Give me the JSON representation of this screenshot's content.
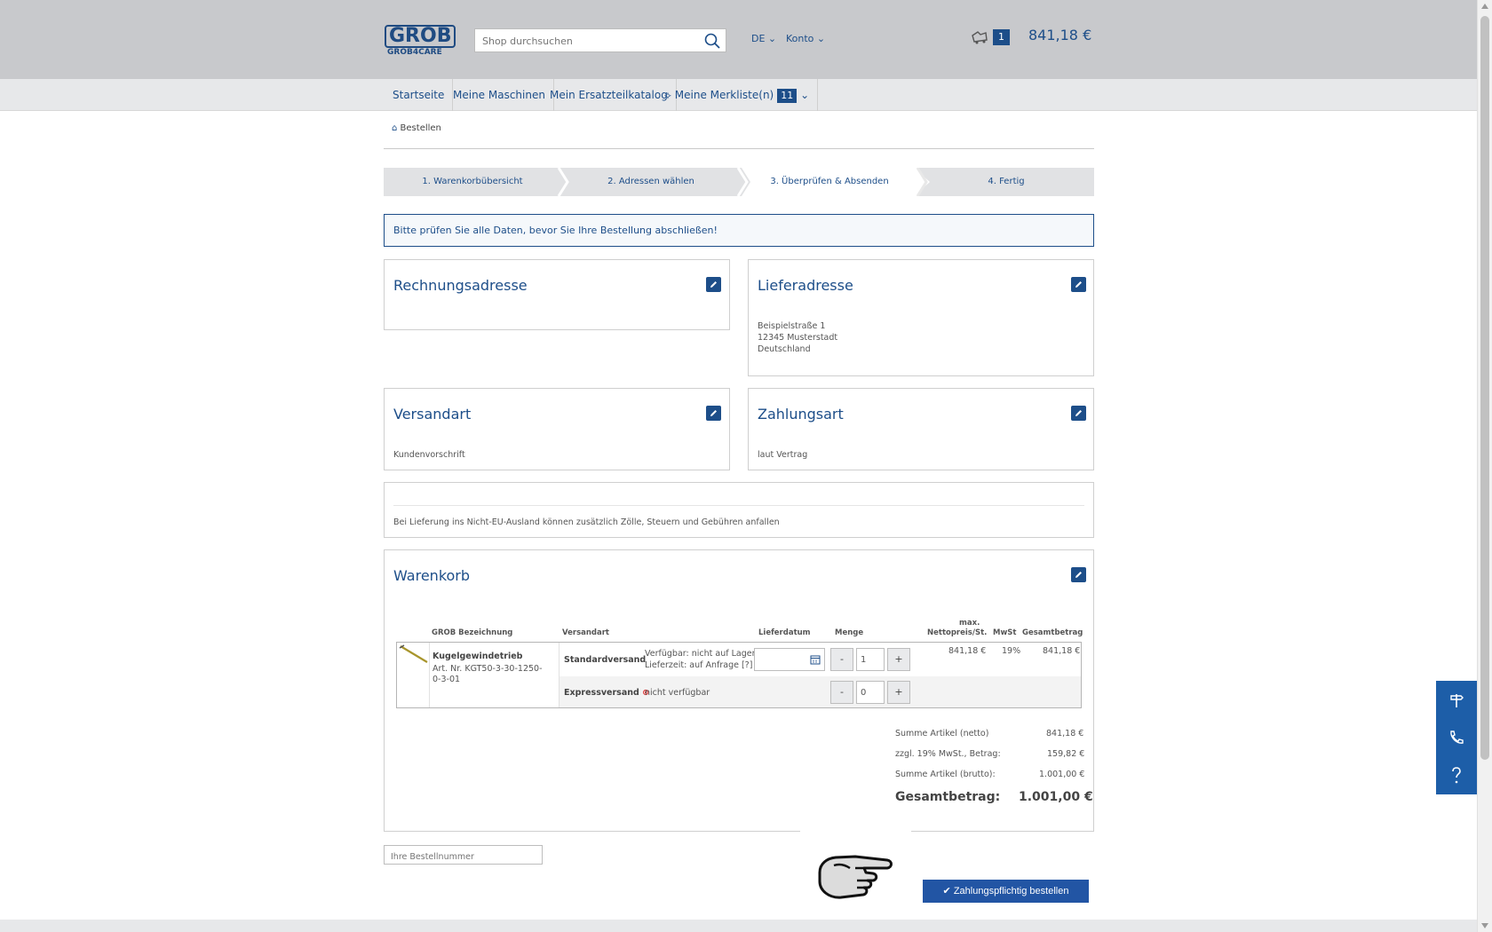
{
  "header": {
    "logo_top": "GROB",
    "logo_bottom": "GROB4CARE",
    "search_placeholder": "Shop durchsuchen",
    "language": "DE",
    "account": "Konto",
    "cart_count": "1",
    "cart_total": "841,18 €"
  },
  "nav": {
    "items": [
      "Startseite",
      "Meine Maschinen",
      "Mein Ersatzteilkatalog",
      "Meine Merkliste(n)"
    ],
    "watchlist_count": "11"
  },
  "breadcrumb": "Bestellen",
  "steps": [
    "1. Warenkorbübersicht",
    "2. Adressen wählen",
    "3. Überprüfen & Absenden",
    "4. Fertig"
  ],
  "info_message": "Bitte prüfen Sie alle Daten, bevor Sie Ihre Bestellung abschließen!",
  "billing": {
    "title": "Rechnungsadresse"
  },
  "shipping_address": {
    "title": "Lieferadresse",
    "lines": [
      "Beispielstraße 1",
      "12345 Musterstadt",
      "Deutschland"
    ]
  },
  "shipping_method": {
    "title": "Versandart",
    "value": "Kundenvorschrift"
  },
  "payment": {
    "title": "Zahlungsart",
    "value": "laut Vertrag"
  },
  "customs_note": "Bei Lieferung ins Nicht-EU-Ausland können zusätzlich Zölle, Steuern und Gebühren anfallen",
  "cart": {
    "title": "Warenkorb",
    "headers": {
      "name": "GROB Bezeichnung",
      "shipping": "Versandart",
      "date": "Lieferdatum",
      "qty": "Menge",
      "price_top": "max.",
      "price": "Nettopreis/St.",
      "vat": "MwSt",
      "total": "Gesamtbetrag"
    },
    "item": {
      "name": "Kugelgewindetrieb",
      "article_no": "Art. Nr. KGT50-3-30-1250-0-3-01",
      "price": "841,18 €",
      "vat": "19%",
      "total": "841,18 €",
      "standard": {
        "label": "Standardversand",
        "availability": "Verfügbar: nicht auf Lager",
        "lead_time": "Lieferzeit: auf Anfrage [?]",
        "qty": "1"
      },
      "express": {
        "label": "Expressversand",
        "availability": "nicht verfügbar",
        "qty": "0"
      }
    },
    "qty_minus": "-",
    "qty_plus": "+",
    "summary": {
      "net_label": "Summe Artikel (netto)",
      "net_value": "841,18 €",
      "vat_label": "zzgl. 19% MwSt., Betrag:",
      "vat_value": "159,82 €",
      "gross_label": "Summe Artikel (brutto):",
      "gross_value": "1.001,00 €",
      "total_label": "Gesamtbetrag:",
      "total_value": "1.001,00 €"
    }
  },
  "order_number_placeholder": "Ihre Bestellnummer",
  "order_button": "Zahlungspflichtig bestellen",
  "colors": {
    "accent": "#1d4e89",
    "button": "#2255a4",
    "side_panel": "#1d5ea8"
  }
}
